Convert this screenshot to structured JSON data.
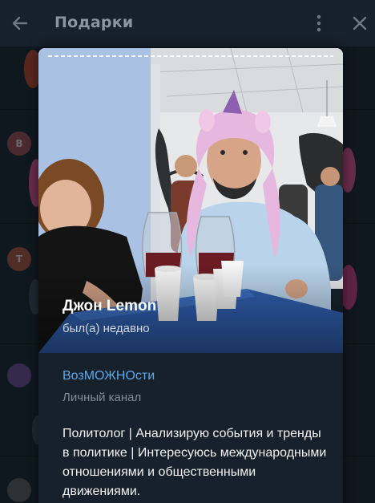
{
  "header": {
    "title": "Подарки",
    "back_icon": "arrow-left-icon",
    "more_icon": "more-vertical-icon",
    "close_icon": "close-icon"
  },
  "background_list": {
    "avatars": [
      {
        "letter": "В",
        "color": "#9a4a4e"
      },
      {
        "letter": "Т",
        "color": "#a8503f"
      },
      {
        "letter": "",
        "color": "#6c4a8c"
      },
      {
        "letter": "",
        "color": "#5a5a5a"
      }
    ]
  },
  "profile": {
    "name": "Джон Lemon",
    "status": "был(а) недавно",
    "channel_link": "ВозМОЖНОсти",
    "channel_type": "Личный канал",
    "bio": "Политолог | Анализирую события и тренды в политике | Интересуюсь международными отношениями и общественными движениями."
  },
  "colors": {
    "background": "#17212b",
    "accent_link": "#5ea8e8",
    "secondary_text": "#7f8b96"
  }
}
